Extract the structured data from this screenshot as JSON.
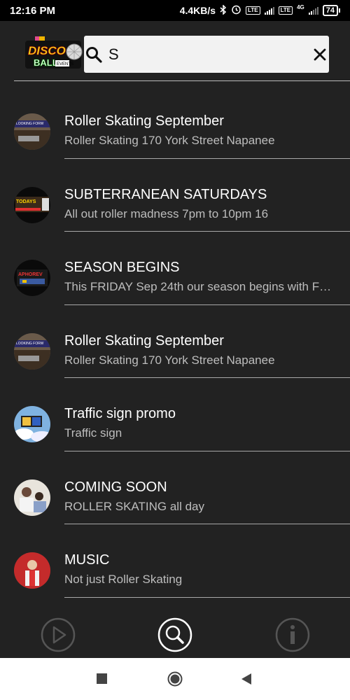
{
  "status_bar": {
    "time": "12:16 PM",
    "network_speed": "4.4KB/s",
    "volte_1": "Vo LTE",
    "volte_2": "Vo LTE",
    "network_type": "4G",
    "battery": "74"
  },
  "header": {
    "logo_top": "DISCO",
    "logo_bottom": "BALL",
    "logo_small": "EVENTS",
    "search": {
      "value": "S",
      "placeholder": ""
    }
  },
  "results": [
    {
      "title": "Roller Skating September",
      "subtitle": "Roller Skating 170 York Street Napanee",
      "thumb": "looking-forward"
    },
    {
      "title": "SUBTERRANEAN SATURDAYS",
      "subtitle": "All out roller madness 7pm to 10pm 16",
      "thumb": "todays"
    },
    {
      "title": "SEASON BEGINS",
      "subtitle": "This FRIDAY Sep 24th our season begins with F…",
      "thumb": "season"
    },
    {
      "title": "Roller Skating September",
      "subtitle": "Roller Skating 170 York Street Napanee",
      "thumb": "looking-forward"
    },
    {
      "title": "Traffic sign promo",
      "subtitle": "Traffic sign",
      "thumb": "traffic-sign"
    },
    {
      "title": "COMING SOON",
      "subtitle": "ROLLER SKATING all day",
      "thumb": "people"
    },
    {
      "title": "MUSIC",
      "subtitle": "Not just Roller Skating",
      "thumb": "music"
    }
  ],
  "theme": {
    "background": "#222222",
    "primary_text": "#ffffff",
    "secondary_text": "#bdbdbd",
    "search_bg": "#f2f2f2",
    "inactive_icon": "#555555",
    "active_icon": "#ffffff"
  }
}
